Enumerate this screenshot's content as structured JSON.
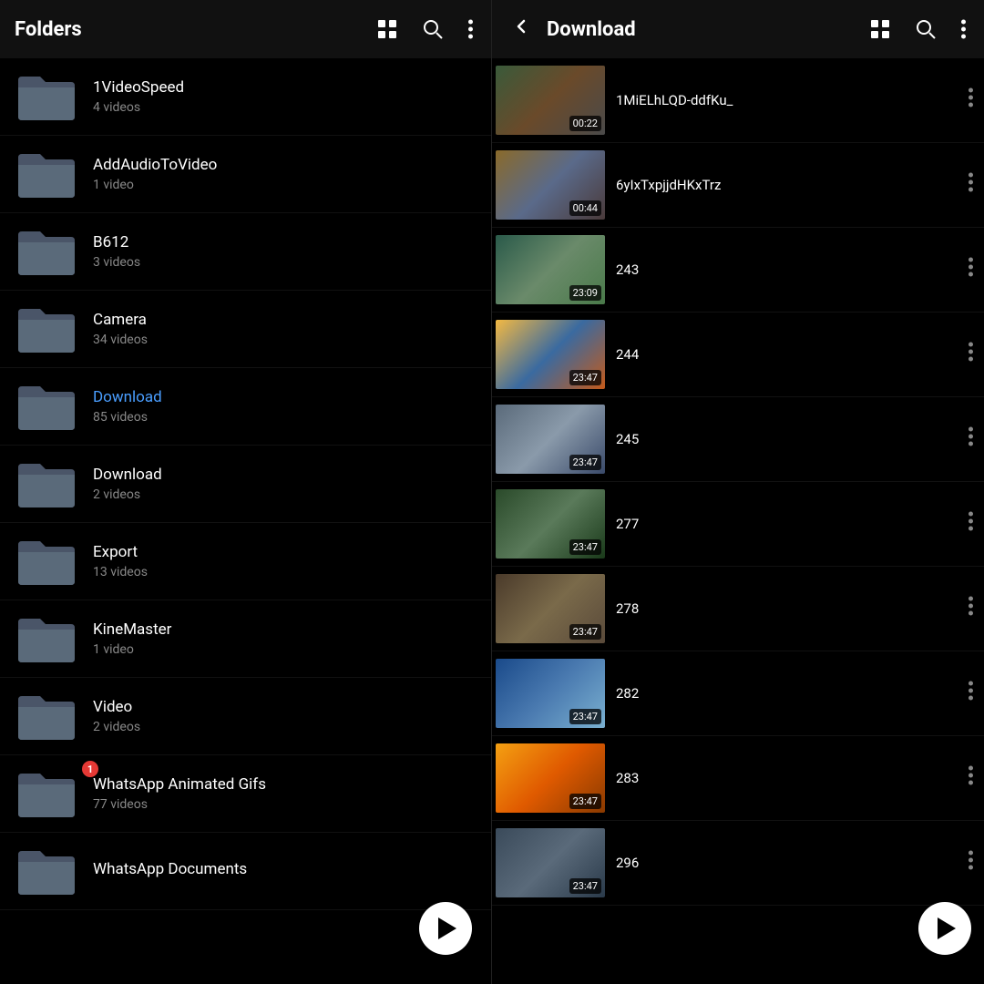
{
  "left": {
    "header": {
      "title": "Folders",
      "icons": [
        "grid",
        "search",
        "more"
      ]
    },
    "folders": [
      {
        "id": "1videospeed",
        "name": "1VideoSpeed",
        "count": "4 videos",
        "active": false,
        "badge": null
      },
      {
        "id": "addaudiotovideo",
        "name": "AddAudioToVideo",
        "count": "1 video",
        "active": false,
        "badge": null
      },
      {
        "id": "b612",
        "name": "B612",
        "count": "3 videos",
        "active": false,
        "badge": null
      },
      {
        "id": "camera",
        "name": "Camera",
        "count": "34 videos",
        "active": false,
        "badge": null
      },
      {
        "id": "download85",
        "name": "Download",
        "count": "85 videos",
        "active": true,
        "badge": null
      },
      {
        "id": "download2",
        "name": "Download",
        "count": "2 videos",
        "active": false,
        "badge": null
      },
      {
        "id": "export",
        "name": "Export",
        "count": "13 videos",
        "active": false,
        "badge": null
      },
      {
        "id": "kinemaster",
        "name": "KineMaster",
        "count": "1 video",
        "active": false,
        "badge": null
      },
      {
        "id": "video",
        "name": "Video",
        "count": "2 videos",
        "active": false,
        "badge": null
      },
      {
        "id": "whatsappgifs",
        "name": "WhatsApp Animated Gifs",
        "count": "77 videos",
        "active": false,
        "badge": "1"
      },
      {
        "id": "whatsappdocs",
        "name": "WhatsApp Documents",
        "count": "",
        "active": false,
        "badge": null
      }
    ]
  },
  "right": {
    "header": {
      "title": "Download",
      "icons": [
        "grid",
        "search",
        "more"
      ]
    },
    "videos": [
      {
        "id": "v1",
        "name": "1MiELhLQD-ddfKu_",
        "duration": "00:22",
        "thumbClass": "thumb-trump"
      },
      {
        "id": "v2",
        "name": "6yIxTxpjjdHKxTrz",
        "duration": "00:44",
        "thumbClass": "thumb-news"
      },
      {
        "id": "v3",
        "name": "243",
        "duration": "23:09",
        "thumbClass": "thumb-anime1"
      },
      {
        "id": "v4",
        "name": "244",
        "duration": "23:47",
        "thumbClass": "thumb-anime2"
      },
      {
        "id": "v5",
        "name": "245",
        "duration": "23:47",
        "thumbClass": "thumb-anime3"
      },
      {
        "id": "v6",
        "name": "277",
        "duration": "23:47",
        "thumbClass": "thumb-anime4"
      },
      {
        "id": "v7",
        "name": "278",
        "duration": "23:47",
        "thumbClass": "thumb-anime5"
      },
      {
        "id": "v8",
        "name": "282",
        "duration": "23:47",
        "thumbClass": "thumb-anime6"
      },
      {
        "id": "v9",
        "name": "283",
        "duration": "23:47",
        "thumbClass": "thumb-anime7"
      },
      {
        "id": "v10",
        "name": "296",
        "duration": "23:47",
        "thumbClass": "thumb-anime8"
      }
    ]
  },
  "fab": {
    "label": "▶"
  }
}
